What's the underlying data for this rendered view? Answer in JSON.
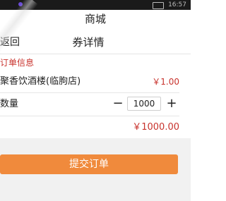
{
  "status_bar": {
    "time": "16:57",
    "accent_color": "#6a4bd6"
  },
  "app": {
    "title": "商城"
  },
  "navbar": {
    "back_label": "返回",
    "page_title": "券详情"
  },
  "order": {
    "section_title": "订单信息",
    "product_name": "聚香饮酒楼(临朐店)",
    "unit_price": "￥1.00",
    "quantity_label": "数量",
    "quantity_value": "1000",
    "minus_symbol": "−",
    "plus_symbol": "+",
    "total": "￥1000.00"
  },
  "actions": {
    "submit_label": "提交订单"
  },
  "colors": {
    "price": "#c8322c",
    "submit_button": "#f08a3c",
    "page_background": "#f1f1f1"
  }
}
